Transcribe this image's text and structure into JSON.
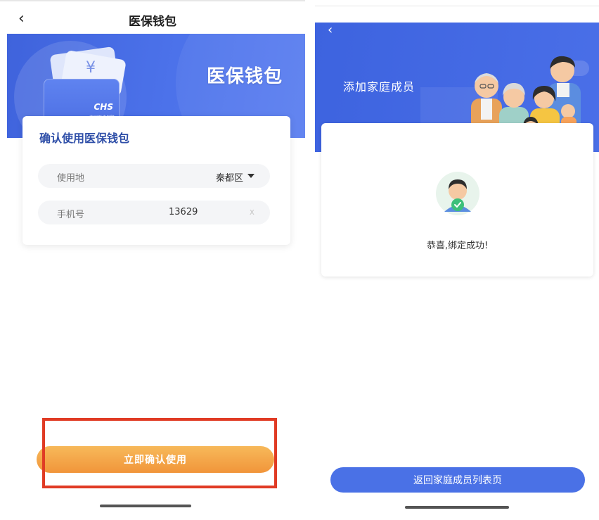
{
  "left": {
    "nav": {
      "back_icon": "‹",
      "title": "医保钱包"
    },
    "banner": {
      "title": "医保钱包",
      "card_logo": "CHS",
      "card_logo_sub": "中国医疗保障",
      "yuan_icon": "¥"
    },
    "panel": {
      "title": "确认使用医保钱包",
      "location": {
        "label": "使用地",
        "value": "秦都区"
      },
      "phone": {
        "label": "手机号",
        "value": "13629",
        "clear_icon": "x"
      }
    },
    "confirm_button": "立即确认使用",
    "highlight_color": "#e03b24"
  },
  "right": {
    "nav": {
      "back_icon": "‹"
    },
    "banner": {
      "title": "添加家庭成员"
    },
    "success_text": "恭喜,绑定成功!",
    "return_button": "返回家庭成员列表页"
  },
  "colors": {
    "brand_blue": "#4a71e6",
    "orange": "#f1953a",
    "success_green": "#3cc07a"
  }
}
